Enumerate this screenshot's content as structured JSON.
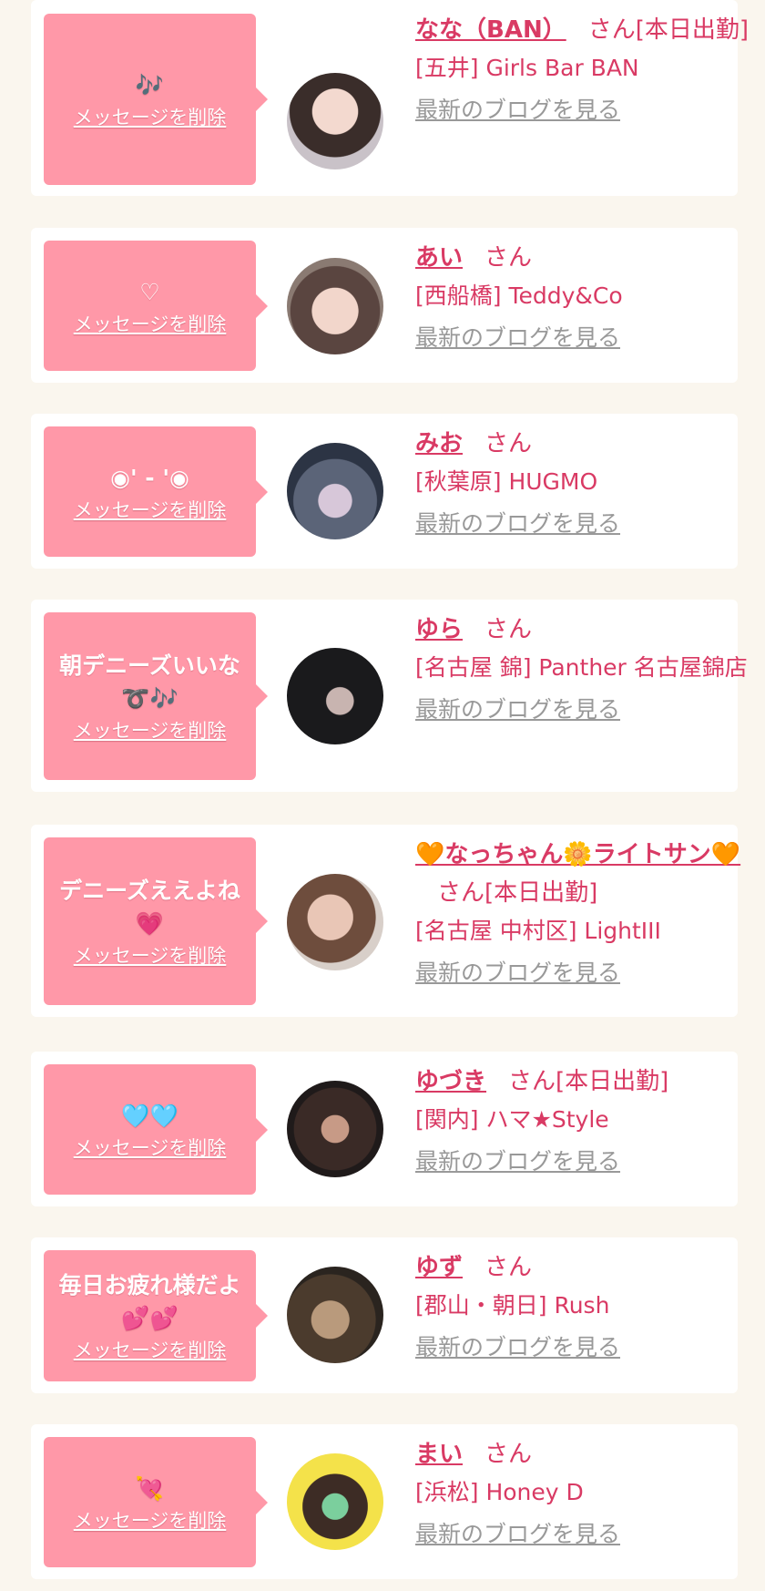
{
  "delete_label": "メッセージを削除",
  "blog_label": "最新のブログを見る",
  "san_label": "さん",
  "colors": {
    "page_bg": "#faf6ee",
    "bubble": "#ff98a8",
    "accent": "#d93a64",
    "link_gray": "#999999"
  },
  "entries": [
    {
      "message": "🎶",
      "name": "なな（BAN）",
      "suffix": "さん[本日出勤]",
      "shop": "[五井] Girls Bar BAN"
    },
    {
      "message": "♡",
      "name": "あい",
      "suffix": "さん",
      "shop": "[西船橋] Teddy&Co"
    },
    {
      "message": "◉' - '◉",
      "name": "みお",
      "suffix": "さん",
      "shop": "[秋葉原] HUGMO"
    },
    {
      "message": "朝デニーズいいな\n➰🎶",
      "name": "ゆら",
      "suffix": "さん",
      "shop": "[名古屋 錦] Panther 名古屋錦店"
    },
    {
      "message": "デニーズええよね\n💗",
      "name": "🧡なっちゃん🌼ライトサン🧡",
      "suffix": "さん[本日出勤]",
      "shop": "[名古屋 中村区] LightIII"
    },
    {
      "message": "🩵🩵",
      "name": "ゆづき",
      "suffix": "さん[本日出勤]",
      "shop": "[関内] ハマ★Style"
    },
    {
      "message": "毎日お疲れ様だよ\n💕💕",
      "name": "ゆず",
      "suffix": "さん",
      "shop": "[郡山・朝日] Rush"
    },
    {
      "message": "💘",
      "name": "まい",
      "suffix": "さん",
      "shop": "[浜松] Honey D"
    }
  ]
}
